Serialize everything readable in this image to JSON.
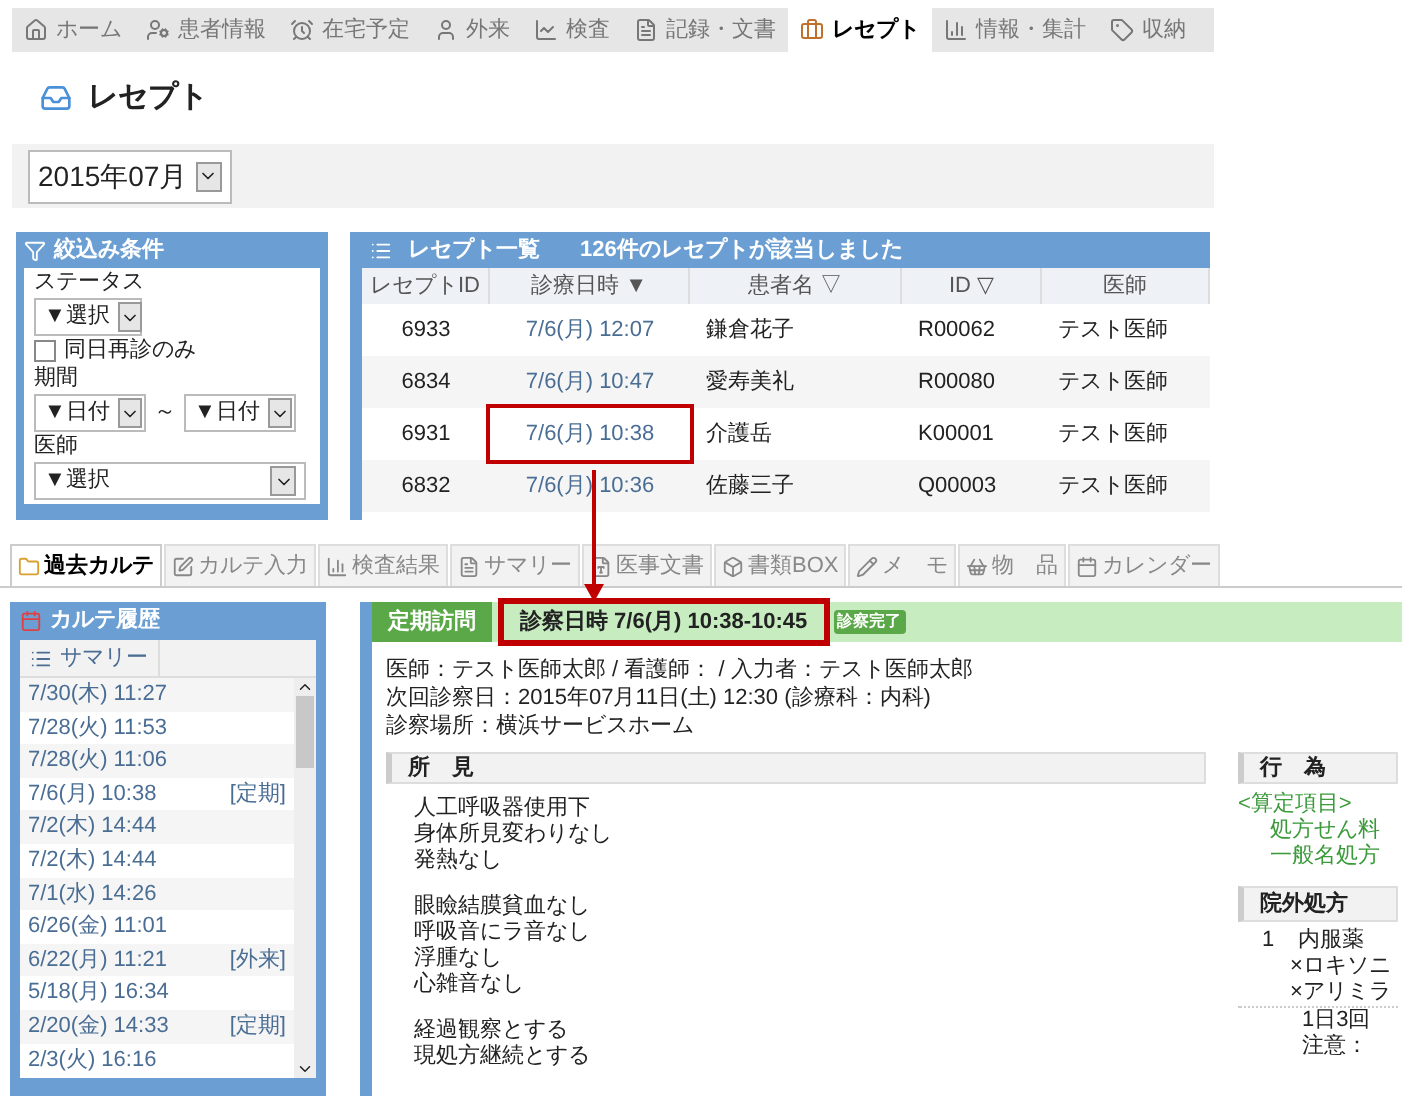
{
  "nav_tabs": [
    {
      "label": "ホーム",
      "selected": false
    },
    {
      "label": "患者情報",
      "selected": false
    },
    {
      "label": "在宅予定",
      "selected": false
    },
    {
      "label": "外来",
      "selected": false
    },
    {
      "label": "検査",
      "selected": false
    },
    {
      "label": "記録・文書",
      "selected": false
    },
    {
      "label": "レセプト",
      "selected": true
    },
    {
      "label": "情報・集計",
      "selected": false
    },
    {
      "label": "収納",
      "selected": false
    }
  ],
  "page_title": "レセプト",
  "month_select": {
    "value": "2015年07月"
  },
  "filter_panel": {
    "title": "絞込み条件",
    "status_label": "ステータス",
    "status_select": "▼選択",
    "same_day_checkbox": {
      "label": "同日再診のみ",
      "checked": false
    },
    "period_label": "期間",
    "period_from": "▼日付",
    "period_separator": "～",
    "period_to": "▼日付",
    "doctor_label": "医師",
    "doctor_select": "▼選択"
  },
  "receipt_list": {
    "title": "レセプト一覧",
    "count_text": "126件のレセプトが該当しました",
    "columns": [
      "レセプトID",
      "診療日時 ▼",
      "患者名 ▽",
      "ID ▽",
      "医師"
    ],
    "rows": [
      {
        "cells": [
          "6933",
          "7/6(月) 12:07",
          "鎌倉花子",
          "R00062",
          "テスト医師"
        ],
        "callout": false
      },
      {
        "cells": [
          "6834",
          "7/6(月) 10:47",
          "愛寿美礼",
          "R00080",
          "テスト医師"
        ],
        "callout": false
      },
      {
        "cells": [
          "6931",
          "7/6(月) 10:38",
          "介護岳",
          "K00001",
          "テスト医師"
        ],
        "callout": true
      },
      {
        "cells": [
          "6832",
          "7/6(月) 10:36",
          "佐藤三子",
          "Q00003",
          "テスト医師"
        ],
        "callout": false
      }
    ]
  },
  "record_tabs": [
    {
      "label": "過去カルテ",
      "selected": true
    },
    {
      "label": "カルテ入力",
      "selected": false
    },
    {
      "label": "検査結果",
      "selected": false
    },
    {
      "label": "サマリー",
      "selected": false
    },
    {
      "label": "医事文書",
      "selected": false
    },
    {
      "label": "書類BOX",
      "selected": false
    },
    {
      "label": "メ　モ",
      "selected": false
    },
    {
      "label": "物　品",
      "selected": false
    },
    {
      "label": "カレンダー",
      "selected": false
    }
  ],
  "history_panel": {
    "title": "カルテ履歴",
    "summary_button": "サマリー",
    "items": [
      {
        "date": "7/30(木) 11:27"
      },
      {
        "date": "7/28(火) 11:53"
      },
      {
        "date": "7/28(火) 11:06"
      },
      {
        "date": "7/6(月) 10:38",
        "tag": "[定期]"
      },
      {
        "date": "7/2(木) 14:44"
      },
      {
        "date": "7/2(木) 14:44"
      },
      {
        "date": "7/1(水) 14:26"
      },
      {
        "date": "6/26(金) 11:01"
      },
      {
        "date": "6/22(月) 11:21",
        "tag": "[外来]"
      },
      {
        "date": "5/18(月) 16:34"
      },
      {
        "date": "2/20(金) 14:33",
        "tag": "[定期]"
      },
      {
        "date": "2/3(火) 16:16"
      }
    ]
  },
  "visit": {
    "type_badge": "定期訪問",
    "datetime": "診察日時 7/6(月) 10:38-10:45",
    "datetime_callout": true,
    "status_badge": "診察完了",
    "info_lines": [
      "医師：テスト医師太郎 / 看護師： / 入力者：テスト医師太郎",
      "次回診察日：2015年07月11日(土) 12:30 (診療科：内科)",
      "診察場所：横浜サービスホーム"
    ]
  },
  "findings": {
    "title": "所　見",
    "paragraphs": [
      [
        "人工呼吸器使用下",
        "身体所見変わりなし",
        "発熱なし"
      ],
      [
        "眼瞼結膜貧血なし",
        "呼吸音にラ音なし",
        "浮腫なし",
        "心雑音なし"
      ],
      [
        "経過観察とする",
        "現処方継続とする"
      ]
    ]
  },
  "actions": {
    "title": "行　為",
    "category": "<算定項目>",
    "items": [
      "処方せん料",
      "一般名処方"
    ]
  },
  "prescription": {
    "title": "院外処方",
    "number": "1",
    "group": "内服薬",
    "drugs": [
      "×ロキソニ",
      "×アリミラ"
    ],
    "dosage": "1日3回",
    "note": "注意："
  }
}
